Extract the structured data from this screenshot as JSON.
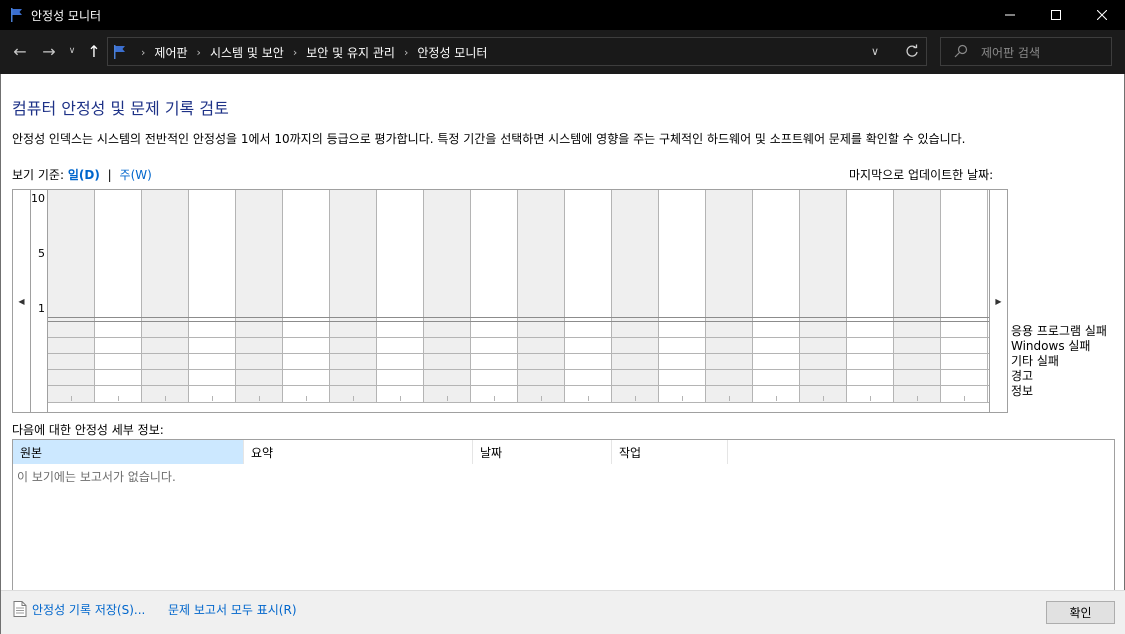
{
  "window": {
    "title": "안정성 모니터"
  },
  "breadcrumb": [
    "제어판",
    "시스템 및 보안",
    "보안 및 유지 관리",
    "안정성 모니터"
  ],
  "search": {
    "placeholder": "제어판 검색"
  },
  "page": {
    "title": "컴퓨터 안정성 및 문제 기록 검토",
    "description": "안정성 인덱스는 시스템의 전반적인 안정성을 1에서 10까지의 등급으로 평가합니다. 특정 기간을 선택하면 시스템에 영향을 주는 구체적인 하드웨어 및 소프트웨어 문제를 확인할 수 있습니다."
  },
  "view": {
    "label": "보기 기준:",
    "day": "일(D)",
    "separator": "|",
    "week": "주(W)",
    "last_updated": "마지막으로 업데이트한 날짜:"
  },
  "chart": {
    "y_ticks": [
      "10",
      "5",
      "1"
    ],
    "categories": [
      "응용 프로그램 실패",
      "Windows 실패",
      "기타 실패",
      "경고",
      "정보"
    ]
  },
  "details": {
    "label": "다음에 대한 안정성 세부 정보:",
    "columns": [
      "원본",
      "요약",
      "날짜",
      "작업"
    ],
    "empty_message": "이 보기에는 보고서가 없습니다."
  },
  "footer": {
    "save_history": "안정성 기록 저장(S)...",
    "view_all": "문제 보고서 모두 표시(R)",
    "ok": "확인"
  },
  "colors": {
    "accent": "#0066cc",
    "title": "#1e3287",
    "chrome": "#000000"
  }
}
